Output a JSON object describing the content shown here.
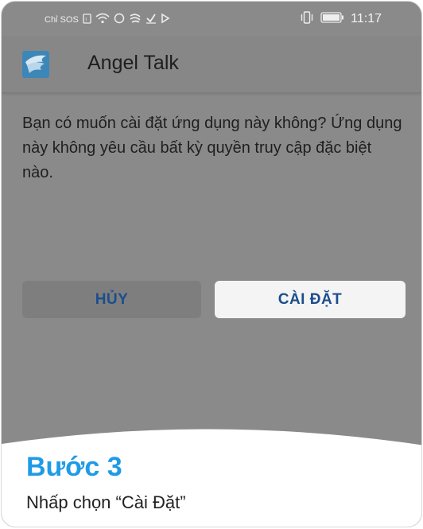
{
  "statusbar": {
    "carrier": "Chỉ SOS",
    "time": "11:17",
    "icons": [
      "sim-icon",
      "wifi-icon",
      "circle-icon",
      "swirl-icon",
      "check-icon",
      "play-icon",
      "vibrate-icon",
      "battery-icon"
    ]
  },
  "app": {
    "title": "Angel Talk",
    "logo": "angel-wing-logo",
    "logo_color": "#3d87b8"
  },
  "dialog": {
    "message": "Bạn có muốn cài đặt ứng dụng này không? Ứng dụng này không yêu cầu bất kỳ quyền truy cập đặc biệt nào.",
    "cancel_label": "HỦY",
    "install_label": "CÀI ĐẶT"
  },
  "caption": {
    "step": "Bước 3",
    "instruction": "Nhấp chọn “Cài Đặt”"
  },
  "colors": {
    "overlay": "#8a8a8a",
    "button_text": "#1c4e8c",
    "step_title": "#1f9be6"
  }
}
